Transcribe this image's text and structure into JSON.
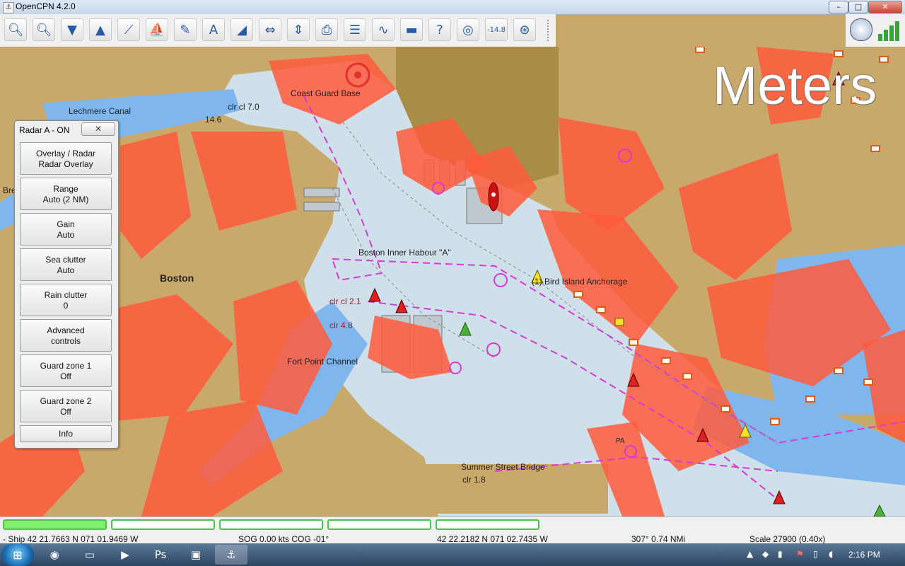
{
  "window": {
    "title": "OpenCPN 4.2.0",
    "minimize": "–",
    "maximize": "□",
    "close": "✕"
  },
  "toolbar": {
    "buttons": [
      {
        "name": "zoom-in-button",
        "glyph": "🔍︎"
      },
      {
        "name": "zoom-out-button",
        "glyph": "🔍︎"
      },
      {
        "name": "scale-in-button",
        "glyph": "▼"
      },
      {
        "name": "scale-out-button",
        "glyph": "▲"
      },
      {
        "name": "route-button",
        "glyph": "⟋"
      },
      {
        "name": "auto-follow-button",
        "glyph": "⛵"
      },
      {
        "name": "options-button",
        "glyph": "✎"
      },
      {
        "name": "text-button",
        "glyph": "A"
      },
      {
        "name": "current-button",
        "glyph": "◢"
      },
      {
        "name": "tide-button",
        "glyph": "⇔"
      },
      {
        "name": "ais-button",
        "glyph": "⇕"
      },
      {
        "name": "print-button",
        "glyph": "⎙"
      },
      {
        "name": "route-manager-button",
        "glyph": "☰"
      },
      {
        "name": "track-button",
        "glyph": "∿"
      },
      {
        "name": "color-scheme-button",
        "glyph": "▬"
      },
      {
        "name": "help-button",
        "glyph": "?"
      },
      {
        "name": "radar-button",
        "glyph": "◎"
      },
      {
        "name": "depth-button",
        "glyph": "-14.8"
      },
      {
        "name": "mob-button",
        "glyph": "⊛"
      }
    ]
  },
  "chart": {
    "units_label": "Meters",
    "labels": {
      "coast_guard": "Coast Guard Base",
      "lechmere": "Lechmere Canal",
      "clr_70": "clr cl 7.0",
      "depth_146": "14.6",
      "inner_harbour": "Boston Inner Habour \"A\"",
      "anchorage": "(1) Bird Island Anchorage",
      "boston": "Boston",
      "clr_21": "clr cl 2.1",
      "clr_48": "clr 4.8",
      "fort_point": "Fort Point Channel",
      "summer_street": "Summer Street Bridge",
      "clr_18": "clr 1.8",
      "pa": "PA",
      "bre": "Bre"
    }
  },
  "radar_panel": {
    "title": "Radar A - ON",
    "close": "✕",
    "buttons": [
      {
        "line1": "Overlay / Radar",
        "line2": "Radar Overlay"
      },
      {
        "line1": "Range",
        "line2": "Auto (2 NM)"
      },
      {
        "line1": "Gain",
        "line2": "Auto"
      },
      {
        "line1": "Sea clutter",
        "line2": "Auto"
      },
      {
        "line1": "Rain clutter",
        "line2": "0"
      },
      {
        "line1": "Advanced",
        "line2": "controls"
      },
      {
        "line1": "Guard zone 1",
        "line2": "Off"
      },
      {
        "line1": "Guard zone 2",
        "line2": "Off"
      },
      {
        "line1": "Info",
        "line2": ""
      }
    ]
  },
  "status": {
    "gauges": [
      {
        "fill": 1.0
      },
      {
        "fill": 0.0
      },
      {
        "fill": 0.0
      },
      {
        "fill": 0.0
      },
      {
        "fill": 0.0
      }
    ],
    "ship": "- Ship 42 21.7663 N   071 01.9469 W",
    "sog_cog": "SOG 0.00 kts  COG -01°",
    "cursor": "42 22.2182 N   071 02.7435 W",
    "bearing": "307°  0.74 NMi",
    "scale": "Scale 27900 (0.40x)"
  },
  "taskbar": {
    "apps": [
      {
        "name": "firefox-icon",
        "glyph": "◉"
      },
      {
        "name": "explorer-icon",
        "glyph": "▭"
      },
      {
        "name": "media-player-icon",
        "glyph": "▶"
      },
      {
        "name": "photoshop-icon",
        "glyph": "Ps"
      },
      {
        "name": "remote-desktop-icon",
        "glyph": "▣"
      },
      {
        "name": "opencpn-icon",
        "glyph": "⚓"
      }
    ],
    "clock": "2:16 PM",
    "start": "⊞"
  },
  "colors": {
    "land": "#c9a96b",
    "land_dark": "#a98c45",
    "water_shallow": "#7fb6ee",
    "water_deep": "#cfe0ea",
    "radar_echo": "#ff5a3c",
    "route_magenta": "#d63ad6"
  }
}
